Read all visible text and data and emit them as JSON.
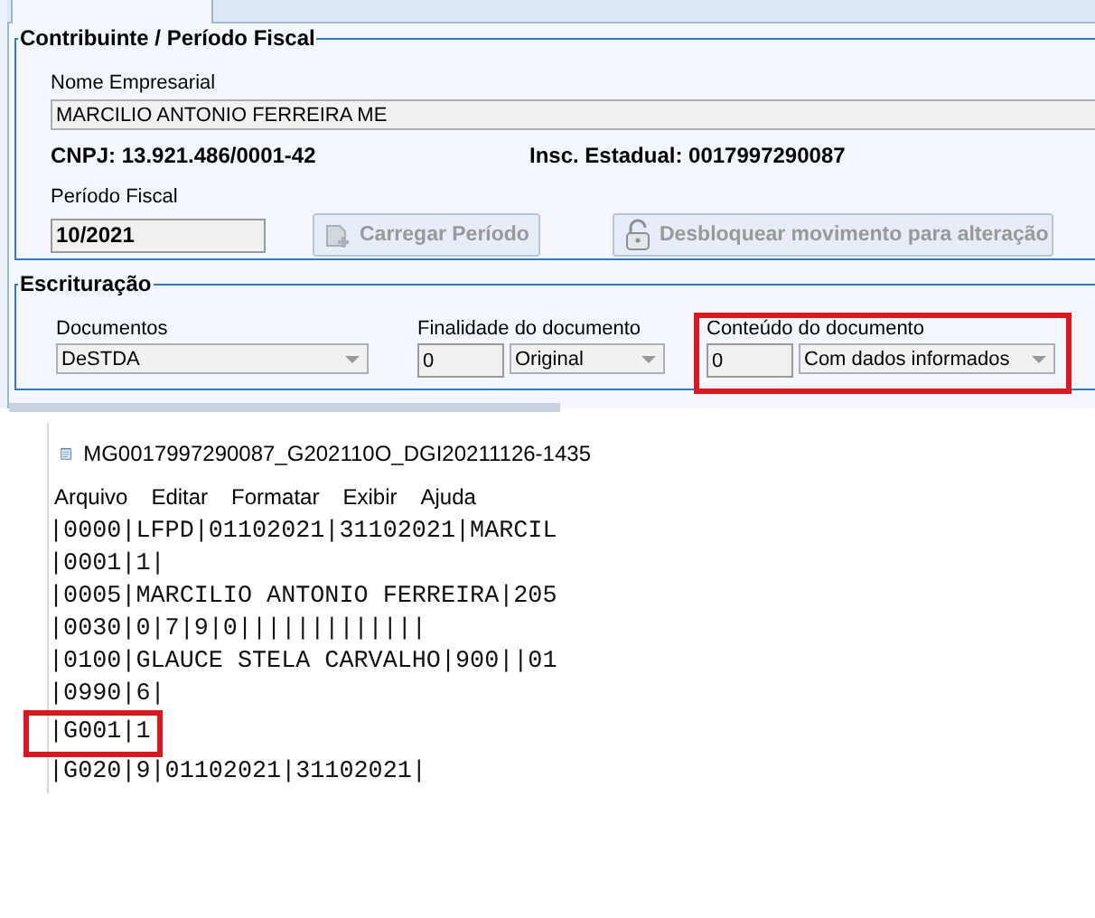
{
  "contribuinte": {
    "title": "Contribuinte / Período Fiscal",
    "nome_label": "Nome Empresarial",
    "nome_value": "MARCILIO ANTONIO FERREIRA ME",
    "cnpj": "CNPJ: 13.921.486/0001-42",
    "inscricao": "Insc. Estadual: 0017997290087",
    "periodo_label": "Período Fiscal",
    "periodo_value": "10/2021",
    "buttons": [
      {
        "label": "Carregar Período",
        "kind": "load",
        "disabled": true
      },
      {
        "label": "Desbloquear movimento para alteração",
        "kind": "unlock",
        "disabled": true
      }
    ]
  },
  "escrituracao": {
    "title": "Escrituração",
    "fields": [
      {
        "label": "Documentos",
        "value": "DeSTDA",
        "highlighted": false
      },
      {
        "label": "Finalidade do documento",
        "code": "0",
        "value": "Original",
        "highlighted": false
      },
      {
        "label": "Conteúdo do documento",
        "code": "0",
        "value": "Com dados informados",
        "highlighted": true
      }
    ]
  },
  "notepad": {
    "title": "MG0017997290087_G202110O_DGI20211126-1435",
    "menu": [
      "Arquivo",
      "Editar",
      "Formatar",
      "Exibir",
      "Ajuda"
    ],
    "lines": [
      {
        "text": "|0000|LFPD|01102021|31102021|MARCIL",
        "highlighted": false
      },
      {
        "text": "|0001|1|",
        "highlighted": false
      },
      {
        "text": "|0005|MARCILIO ANTONIO FERREIRA|205",
        "highlighted": false
      },
      {
        "text": "|0030|0|7|9|0|||||||||||||",
        "highlighted": false
      },
      {
        "text": "|0100|GLAUCE STELA CARVALHO|900||01",
        "highlighted": false
      },
      {
        "text": "|0990|6|",
        "highlighted": false
      },
      {
        "text": "|G001|1",
        "highlighted": true
      },
      {
        "text": "|G020|9|01102021|31102021|",
        "highlighted": false
      }
    ]
  }
}
